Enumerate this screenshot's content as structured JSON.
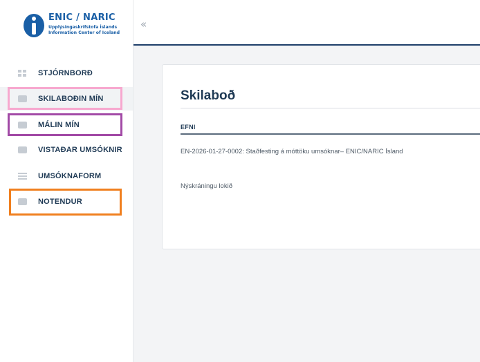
{
  "brand": {
    "title": "ENIC / NARIC",
    "subtitle_line1": "Upplýsingaskrifstofa Íslands",
    "subtitle_line2": "Information Center of Iceland",
    "color": "#1a5fa6"
  },
  "sidebar": {
    "items": [
      {
        "label": "STJÓRNBORÐ",
        "icon": "dashboard-icon"
      },
      {
        "label": "SKILABOÐIN MÍN",
        "icon": "message-icon"
      },
      {
        "label": "MÁLIN MÍN",
        "icon": "folder-icon"
      },
      {
        "label": "VISTAÐAR UMSÓKNIR",
        "icon": "saved-applications-icon"
      },
      {
        "label": "UMSÓKNAFORM",
        "icon": "list-icon"
      },
      {
        "label": "NOTENDUR",
        "icon": "users-folder-icon"
      }
    ],
    "highlights": {
      "pink": "#f7a8cf",
      "purple": "#a24aa6",
      "orange": "#f07f1e"
    }
  },
  "header": {
    "collapse_icon": "«",
    "accent": "#1d3e69"
  },
  "main": {
    "title": "Skilaboð",
    "column_header": "EFNI",
    "rows": [
      "EN-2026-01-27-0002: Staðfesting á móttöku umsóknar– ENIC/NARIC Ísland",
      "Nýskráningu lokið"
    ]
  }
}
